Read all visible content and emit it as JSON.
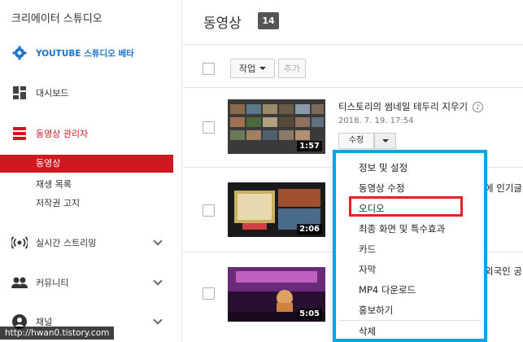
{
  "sidebar": {
    "title": "크리에이터 스튜디오",
    "studio_beta": "YOUTUBE 스튜디오 베타",
    "dashboard": "대시보드",
    "video_manager": "동영상 관리자",
    "sub_items": [
      "동영상",
      "재생 목록",
      "저작권 고지"
    ],
    "live": "실시간 스트리밍",
    "community": "커뮤니티",
    "channel": "채널"
  },
  "main": {
    "title": "동영상",
    "count": "14",
    "action_button": "작업",
    "add_button": "추가",
    "videos": [
      {
        "title": "티스토리의 썸네일 테두리 지우기",
        "date": "2018. 7. 19. 17:54",
        "duration": "1:57"
      },
      {
        "title_fragment": "에 인기글",
        "duration": "2:06"
      },
      {
        "title_fragment": "외국인 공",
        "duration": "5:05"
      }
    ],
    "edit_button": "수정"
  },
  "menu": {
    "items": [
      "정보 및 설정",
      "동영상 수정",
      "오디오",
      "최종 화면 및 특수효과",
      "카드",
      "자막",
      "MP4 다운로드",
      "홍보하기",
      "삭제"
    ]
  },
  "watermark": "http://hwan0.tistory.com",
  "colors": {
    "accent_red": "#cc181e",
    "menu_border": "#0ba3e6",
    "highlight": "#e8202a"
  }
}
